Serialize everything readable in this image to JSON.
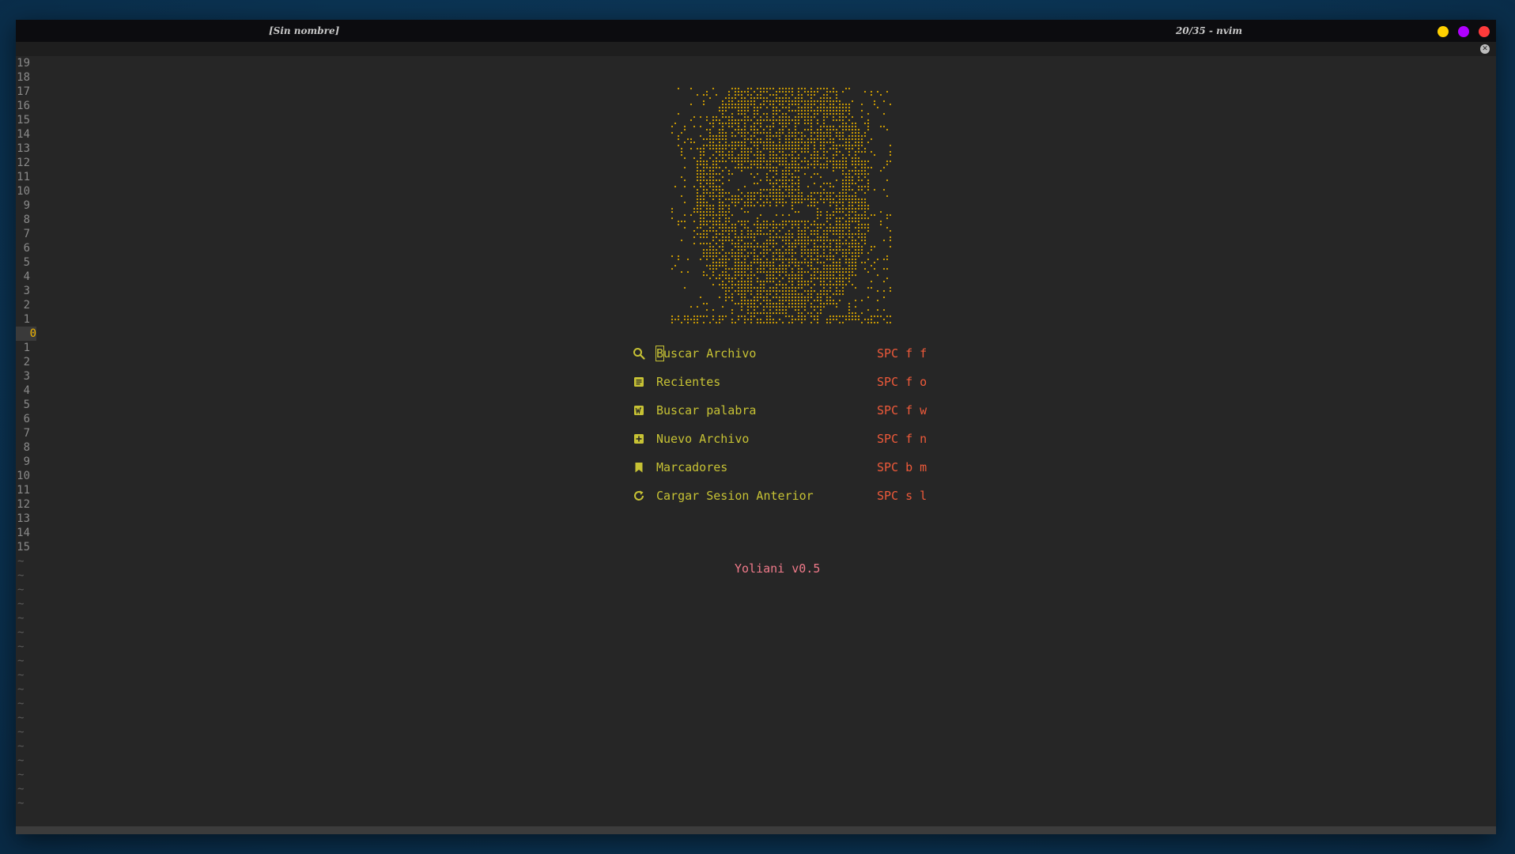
{
  "window": {
    "title_left": "[Sin nombre]",
    "title_right": "20/35 - nvim",
    "controls": {
      "minimize_color": "#ffd000",
      "maximize_color": "#b000ff",
      "close_color": "#ff3b3b"
    }
  },
  "tabline": {
    "close_glyph": "✕"
  },
  "gutter": {
    "line_numbers": [
      "19",
      "18",
      "17",
      "16",
      "15",
      "14",
      "13",
      "12",
      "11",
      "10",
      "9",
      "8",
      "7",
      "6",
      "5",
      "4",
      "3",
      "2",
      "1",
      "0",
      "1",
      "2",
      "3",
      "4",
      "5",
      "6",
      "7",
      "8",
      "9",
      "10",
      "11",
      "12",
      "13",
      "14",
      "15"
    ],
    "current_line_index": 19,
    "tilde_count": 18,
    "tilde_glyph": "~"
  },
  "dashboard": {
    "header_art": {
      "type": "braille-ascii-portrait",
      "color": "#d9a400"
    },
    "items": [
      {
        "icon": "search-icon",
        "label": "Buscar Archivo",
        "shortcut": "SPC f f"
      },
      {
        "icon": "recent-file-icon",
        "label": "Recientes",
        "shortcut": "SPC f o"
      },
      {
        "icon": "word-search-icon",
        "label": "Buscar palabra",
        "shortcut": "SPC f w"
      },
      {
        "icon": "new-file-icon",
        "label": "Nuevo Archivo",
        "shortcut": "SPC f n"
      },
      {
        "icon": "bookmark-icon",
        "label": "Marcadores",
        "shortcut": "SPC b m"
      },
      {
        "icon": "reload-icon",
        "label": "Cargar Sesion Anterior",
        "shortcut": "SPC s l"
      }
    ],
    "footer": "Yoliani v0.5"
  },
  "colors": {
    "menu_label": "#c7c234",
    "shortcut": "#ef5a3a",
    "footer": "#f07a8a",
    "current_line_number": "#f0b400",
    "editor_bg": "#262626"
  }
}
